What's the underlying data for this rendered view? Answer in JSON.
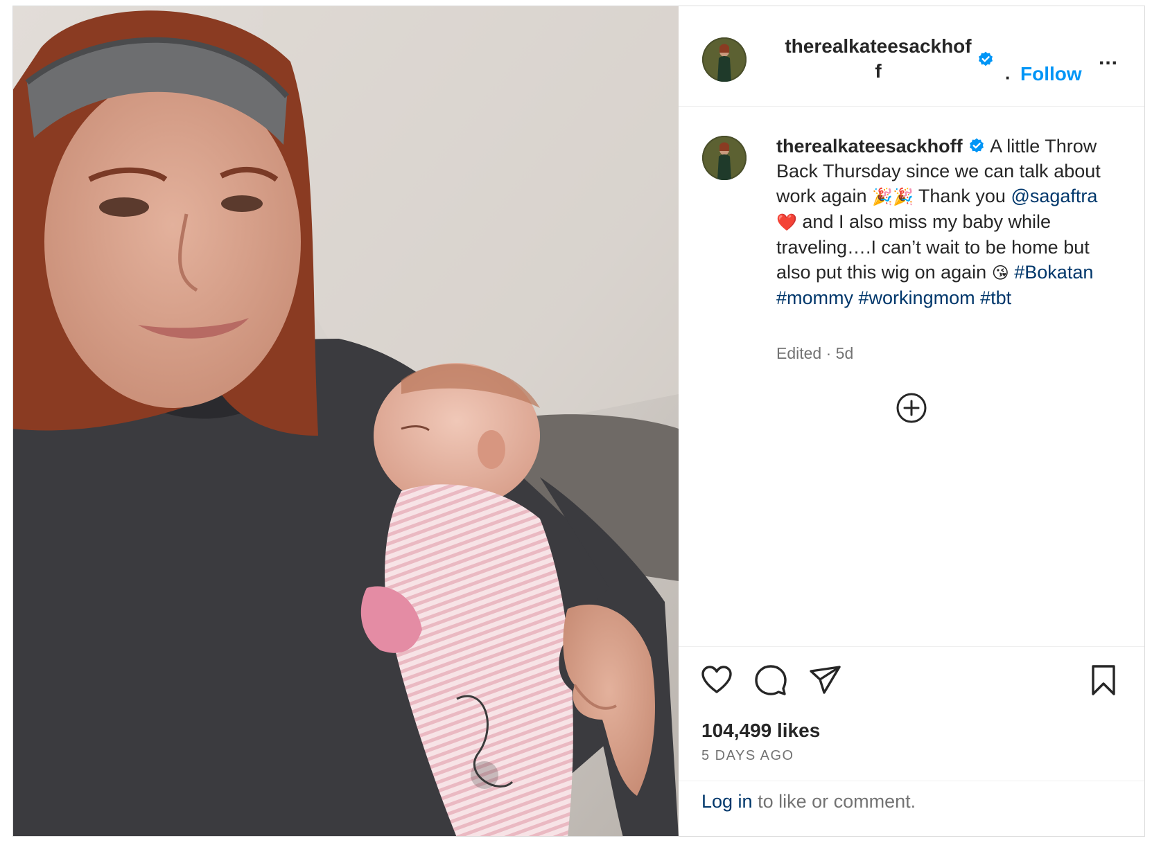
{
  "post": {
    "username": "therealkateesackhoff",
    "header_username": "therealkateesackhoff",
    "follow_label": "Follow",
    "separator": "·",
    "more_label": "...",
    "verified": true,
    "caption": {
      "username": "therealkateesackhoff",
      "text_1": "A little Throw Back Thursday since we can talk about work again",
      "emoji_1": "🎉🎉",
      "text_2": "Thank you",
      "mention": "@sagaftra",
      "emoji_2": "❤️",
      "text_3": "and I also miss my baby while traveling….I can’t wait to be home but also put this wig on again",
      "emoji_3": "😘",
      "hashtags": [
        "#Bokatan",
        "#mommy",
        "#workingmom",
        "#tbt"
      ]
    },
    "edited_label": "Edited",
    "edited_age": "5d",
    "likes": "104,499 likes",
    "posted_ago": "5 DAYS AGO",
    "login_link": "Log in",
    "login_rest": "to like or comment."
  },
  "icons": {
    "verified": "verified-badge-icon",
    "like": "heart-outline-icon",
    "comment": "speech-bubble-icon",
    "share": "paper-plane-icon",
    "save": "bookmark-icon",
    "add": "plus-circle-icon",
    "more": "ellipsis-icon"
  },
  "colors": {
    "link_blue": "#0095f6",
    "hashtag_blue": "#00376b",
    "muted": "#737373",
    "text": "#262626"
  }
}
